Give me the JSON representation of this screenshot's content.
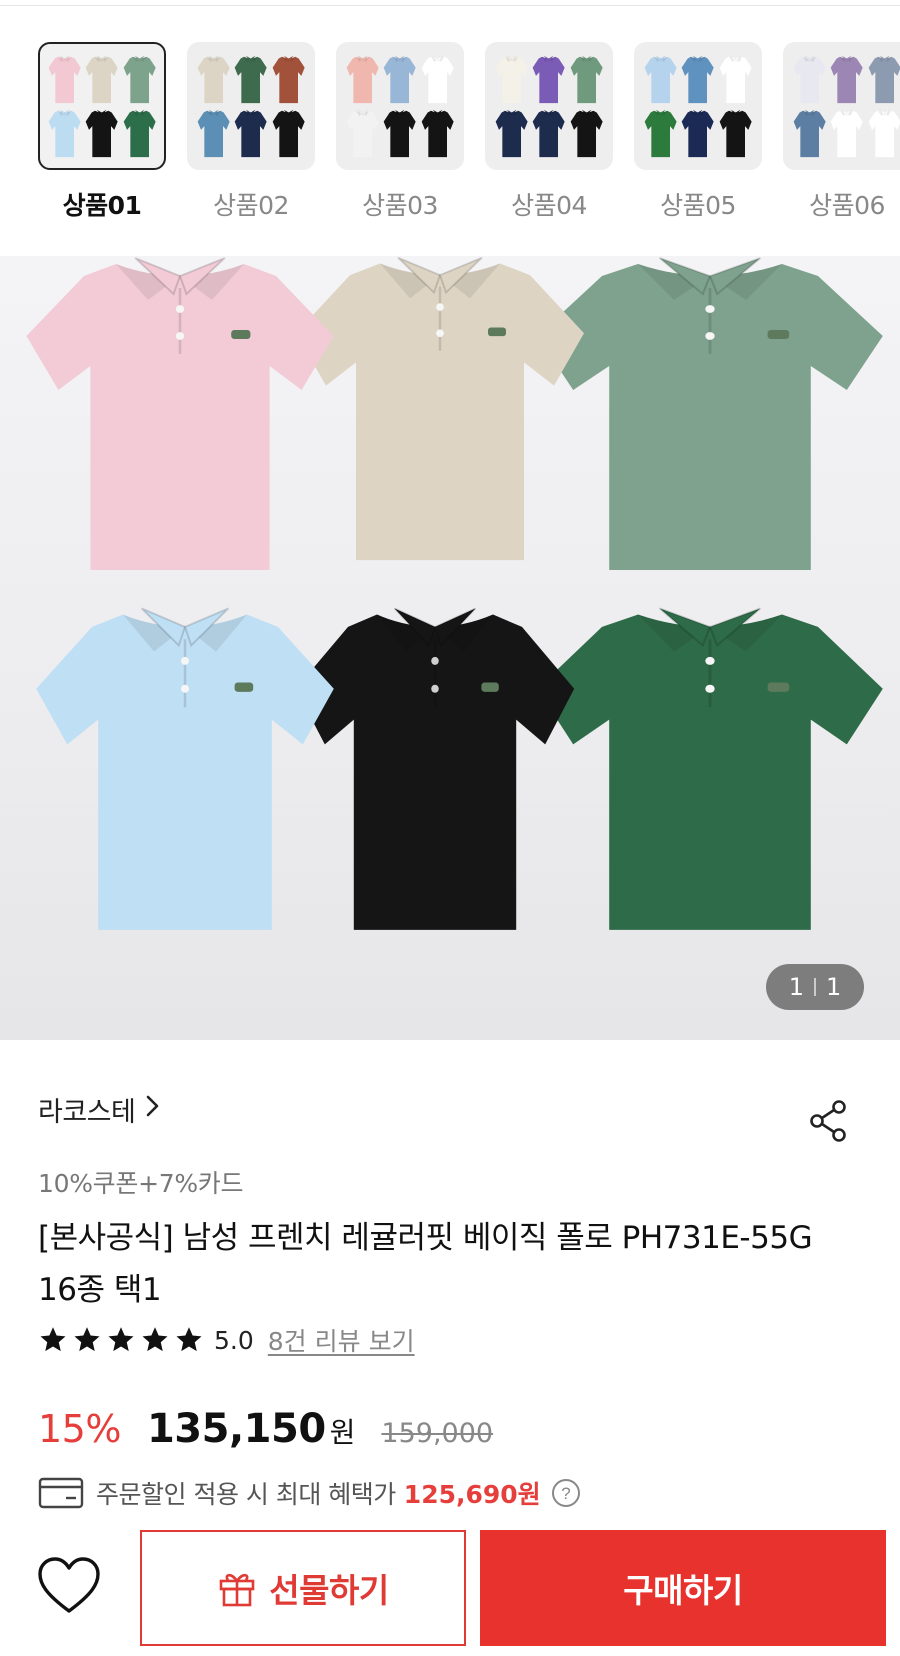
{
  "variants": [
    {
      "label": "상품01",
      "selected": true,
      "colors": [
        "#f2c8d3",
        "#dcd5c6",
        "#7ea38c",
        "#bcdcf2",
        "#141414",
        "#2d6e4a"
      ]
    },
    {
      "label": "상품02",
      "selected": false,
      "colors": [
        "#dcd5c6",
        "#3e6a4e",
        "#a2523a",
        "#5c8fb5",
        "#1d2b4c",
        "#141414"
      ]
    },
    {
      "label": "상품03",
      "selected": false,
      "colors": [
        "#f0b7ae",
        "#98b6d6",
        "#ffffff",
        "#f2f2f2",
        "#141414",
        "#141414"
      ]
    },
    {
      "label": "상품04",
      "selected": false,
      "colors": [
        "#f4f1e9",
        "#7a5bb5",
        "#6f9a7e",
        "#1d2b4c",
        "#1d2b4c",
        "#141414"
      ]
    },
    {
      "label": "상품05",
      "selected": false,
      "colors": [
        "#b6d3ee",
        "#5f92bf",
        "#ffffff",
        "#2c7a3c",
        "#1b2a55",
        "#141414"
      ]
    },
    {
      "label": "상품06",
      "selected": false,
      "colors": [
        "#e8e8f0",
        "#9c86b3",
        "#8d9bb0",
        "#5d7ea3",
        "#ffffff",
        "#ffffff"
      ]
    }
  ],
  "hero": {
    "shirts": [
      {
        "color": "#f2cbd6"
      },
      {
        "color": "#ddd4c4"
      },
      {
        "color": "#7ea28d"
      },
      {
        "color": "#bfdff4"
      },
      {
        "color": "#151515"
      },
      {
        "color": "#2e6b48"
      }
    ],
    "pager_current": "1",
    "pager_total": "1"
  },
  "product": {
    "brand": "라코스테",
    "promo": "10%쿠폰+7%카드",
    "title": "[본사공식] 남성 프렌치 레귤러핏 베이직 폴로 PH731E-55G 16종 택1",
    "rating_value": "5.0",
    "rating_stars": 5,
    "review_link": "8건 리뷰 보기",
    "discount": "15%",
    "price": "135,150",
    "currency": "원",
    "original_price": "159,000",
    "benefit_text": "주문할인 적용 시 최대 혜택가",
    "benefit_amount": "125,690원"
  },
  "actions": {
    "gift_label": "선물하기",
    "buy_label": "구매하기"
  },
  "colors": {
    "accent": "#e8322d",
    "discount": "#e63e3b"
  },
  "icons": [
    "share-icon",
    "star-icon",
    "card-icon",
    "help-icon",
    "heart-icon",
    "gift-icon",
    "chevron-right-icon"
  ]
}
